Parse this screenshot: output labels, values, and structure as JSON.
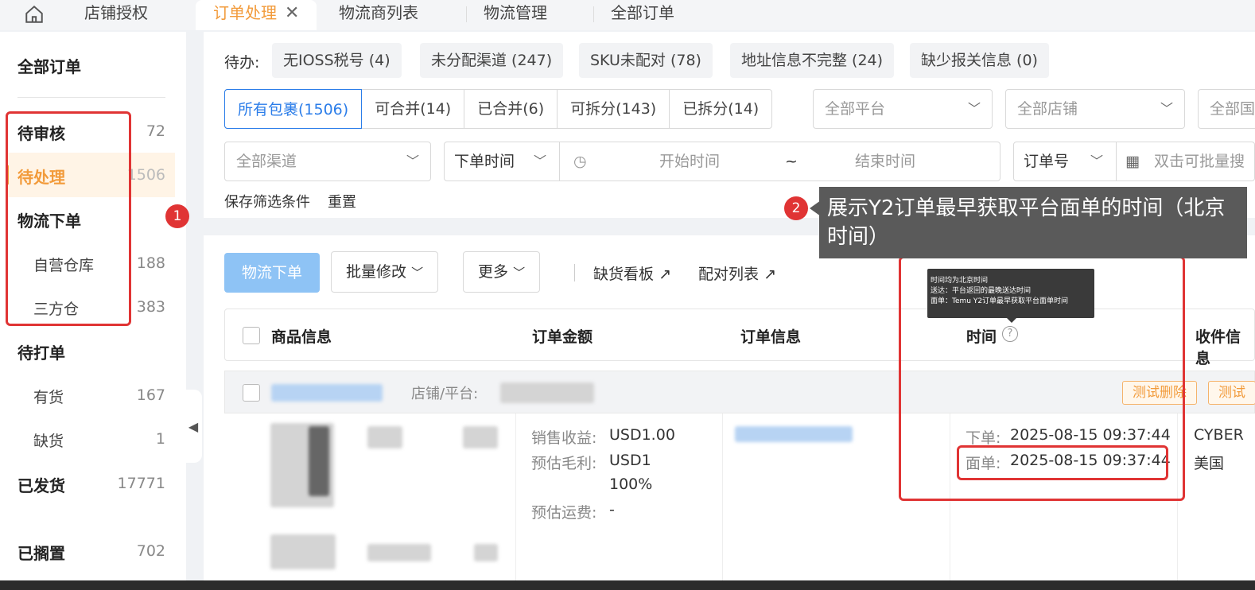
{
  "tabs": {
    "auth": "店铺授权",
    "active": "订单处理",
    "close": "✕",
    "logistics_list": "物流商列表",
    "logistics_mgmt": "物流管理",
    "all_orders": "全部订单"
  },
  "sidebar": {
    "title": "全部订单",
    "items": [
      {
        "label": "待审核",
        "count": "72"
      },
      {
        "label": "待处理",
        "count": "1506"
      },
      {
        "label": "物流下单",
        "count": ""
      },
      {
        "label": "自营仓库",
        "count": "188"
      },
      {
        "label": "三方仓",
        "count": "383"
      },
      {
        "label": "待打单",
        "count": ""
      },
      {
        "label": "有货",
        "count": "167"
      },
      {
        "label": "缺货",
        "count": "1"
      },
      {
        "label": "已发货",
        "count": "17771"
      },
      {
        "label": "已搁置",
        "count": "702"
      }
    ]
  },
  "todo": {
    "label": "待办:",
    "chips": [
      "无IOSS税号 (4)",
      "未分配渠道 (247)",
      "SKU未配对 (78)",
      "地址信息不完整 (24)",
      "缺少报关信息 (0)"
    ]
  },
  "segments": [
    "所有包裹(1506)",
    "可合并(14)",
    "已合并(6)",
    "可拆分(143)",
    "已拆分(14)"
  ],
  "filters": {
    "platform": "全部平台",
    "store": "全部店铺",
    "third": "全部国",
    "channel": "全部渠道",
    "time_type": "下单时间",
    "start_time": "开始时间",
    "tilde": "~",
    "end_time": "结束时间",
    "order_no": "订单号",
    "batch_search": "双击可批量搜",
    "save": "保存筛选条件",
    "reset": "重置"
  },
  "actions": {
    "logistics_order": "物流下单",
    "batch_edit": "批量修改",
    "more": "更多",
    "stockout_board": "缺货看板",
    "pairing_list": "配对列表"
  },
  "table": {
    "headers": [
      "商品信息",
      "订单金额",
      "订单信息",
      "时间",
      "收件信息"
    ],
    "group": {
      "store_platform": "店铺/平台:",
      "tag_delete": "测试删除",
      "tag_test": "测试"
    },
    "row": {
      "sales_label": "销售收益:",
      "sales_value": "USD1.00",
      "profit_label": "预估毛利:",
      "profit_value": "USD1",
      "profit_pct": "100%",
      "shipping_label": "预估运费:",
      "shipping_value": "-",
      "order_time_label": "下单:",
      "order_time": "2025-08-15 09:37:44",
      "label_time_label": "面单:",
      "label_time": "2025-08-15 09:37:44",
      "recipient_name": "CYBER",
      "recipient_country": "美国"
    }
  },
  "tooltip": {
    "line1": "时间均为北京时间",
    "line2": "送达：平台返回的最晚送达时间",
    "line3": "面单：Temu Y2订单最早获取平台面单时间"
  },
  "annotations": {
    "badge1": "1",
    "badge2": "2",
    "callout": "展示Y2订单最早获取平台面单的时间（北京时间）"
  },
  "colors": {
    "accent": "#f29b3b",
    "primary": "#2b7de9",
    "annotation": "#e03434"
  }
}
